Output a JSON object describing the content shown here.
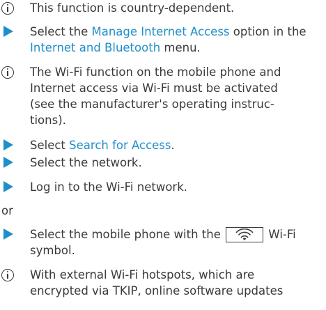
{
  "items": {
    "note1": "This function is country-dependent.",
    "step1": {
      "pre": "Select the ",
      "link1": "Manage Internet Access",
      "mid": " option in the ",
      "link2": "Internet and Bluetooth",
      "post": " menu."
    },
    "note2": {
      "line1": "The Wi-Fi function on the mobile phone and",
      "line2": "Internet access via Wi-Fi must be activated",
      "line3": "(see the manufacturer's operating instruc-",
      "line4": "tions)."
    },
    "step2": {
      "pre": "Select ",
      "link": "Search for Access",
      "post": "."
    },
    "step3": "Select the network.",
    "step4": "Log in to the Wi-Fi network.",
    "or_label": "or",
    "step5": {
      "pre": "Select the mobile phone with the",
      "post": "Wi-Fi",
      "line2": "symbol.",
      "icon": "wifi-icon"
    },
    "note3": {
      "line1": "With external Wi-Fi hotspots, which are",
      "line2": "encrypted via TKIP, online software updates"
    }
  },
  "colors": {
    "accent": "#1f8fc9",
    "text": "#3a3a3a"
  }
}
